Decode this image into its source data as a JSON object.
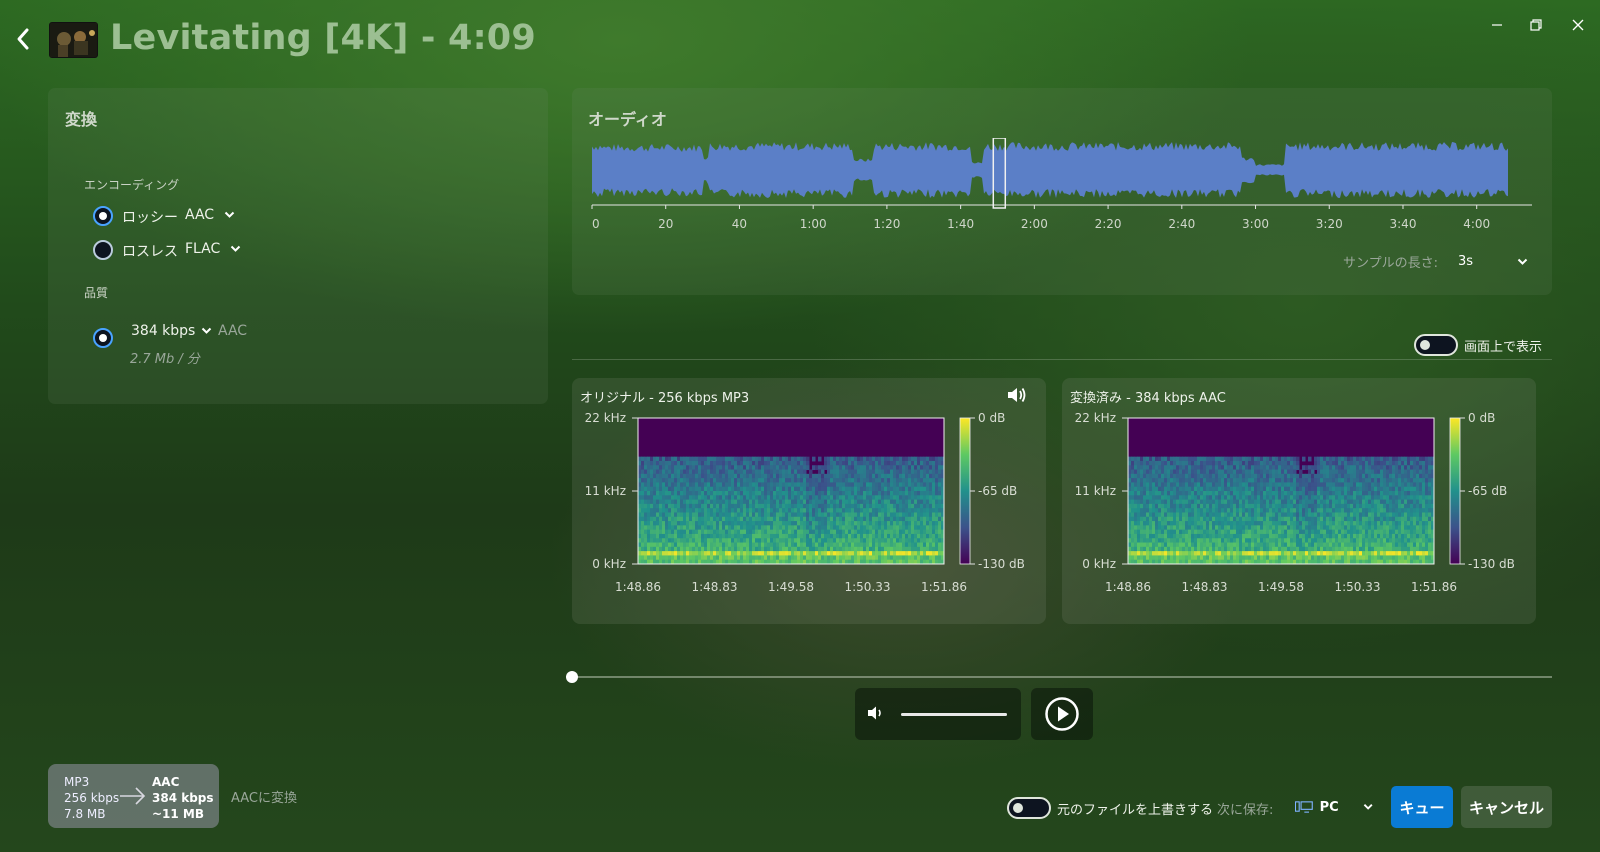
{
  "header": {
    "title": "Levitating [4K] - 4:09"
  },
  "conversion": {
    "panel_title": "変換",
    "encoding_label": "エンコーディング",
    "lossy_label": "ロッシー",
    "lossy_format": "AAC",
    "lossless_label": "ロスレス",
    "lossless_format": "FLAC",
    "quality_label": "品質",
    "bitrate": "384 kbps",
    "codec": "AAC",
    "size_rate": "2.7 Mb / 分",
    "selected_encoding": "lossy"
  },
  "audio": {
    "panel_title": "オーディオ",
    "timeline_ticks": [
      "0",
      "20",
      "40",
      "1:00",
      "1:20",
      "1:40",
      "2:00",
      "2:20",
      "2:40",
      "3:00",
      "3:20",
      "3:40",
      "4:00"
    ],
    "sample_length_label": "サンプルの長さ:",
    "sample_length_value": "3s",
    "selection_seconds": 108.86,
    "duration_seconds": 249
  },
  "overlay_toggle_label": "画面上で表示",
  "spectrograms": [
    {
      "title": "オリジナル - 256 kbps MP3",
      "y_ticks": [
        "22 kHz",
        "11 kHz",
        "0 kHz"
      ],
      "x_ticks": [
        "1:48.86",
        "1:48.83",
        "1:49.58",
        "1:50.33",
        "1:51.86"
      ],
      "colorbar_ticks": [
        "0 dB",
        "-65 dB",
        "-130 dB"
      ],
      "has_speaker": true
    },
    {
      "title": "変換済み - 384 kbps AAC",
      "y_ticks": [
        "22 kHz",
        "11 kHz",
        "0 kHz"
      ],
      "x_ticks": [
        "1:48.86",
        "1:48.83",
        "1:49.58",
        "1:50.33",
        "1:51.86"
      ],
      "colorbar_ticks": [
        "0 dB",
        "-65 dB",
        "-130 dB"
      ],
      "has_speaker": false
    }
  ],
  "playback": {
    "progress": 0.0,
    "volume": 1.0
  },
  "conversion_summary": {
    "from_format": "MP3",
    "from_bitrate": "256 kbps",
    "from_size": "7.8 MB",
    "to_format": "AAC",
    "to_bitrate": "384 kbps",
    "to_size": "~11 MB",
    "description": "AACに変換"
  },
  "footer": {
    "overwrite_label": "元のファイルを上書きする",
    "save_to_label": "次に保存:",
    "save_target": "PC",
    "queue_label": "キュー",
    "cancel_label": "キャンセル"
  },
  "colors": {
    "accent": "#0a7bd4",
    "waveform": "#5b7fc7",
    "title": "#9cbf92"
  }
}
